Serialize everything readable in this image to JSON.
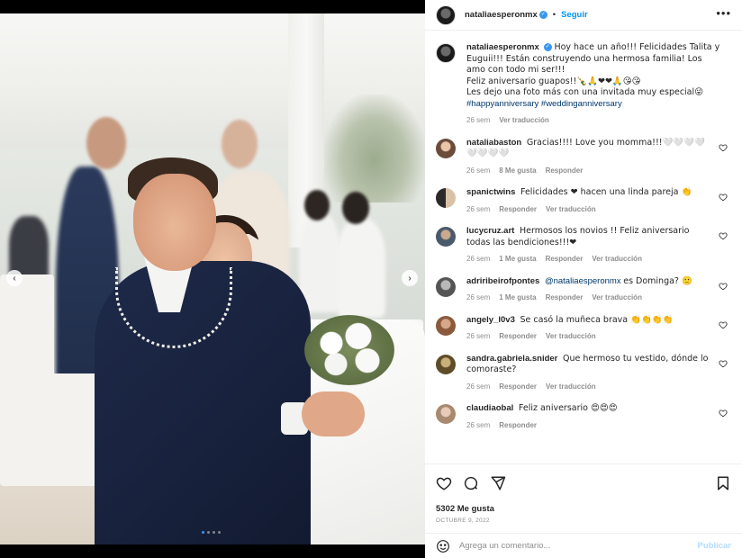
{
  "post": {
    "username": "nataliaesperonmx",
    "follow_label": "Seguir",
    "separator": "•",
    "more_label": "•••",
    "caption_lines": [
      "Hoy hace un año!!! Felicidades Talita y Euguii!!! Están construyendo una hermosa familia! Los amo con todo mi ser!!!",
      "Feliz aniversario guapos!!🍾🙏❤❤🙏😘😘",
      "Les dejo una foto más con una invitada muy especial😜"
    ],
    "hashtags": "#happyanniversary #weddinganniversary",
    "time": "26 sem",
    "translate_label": "Ver traducción"
  },
  "carousel": {
    "prev_label": "‹",
    "next_label": "›",
    "slides": 4,
    "active_slide": 1
  },
  "comments": [
    {
      "user": "nataliabaston",
      "text": "Gracias!!!! Love you momma!!!🤍🤍🤍🤍🤍🤍🤍🤍",
      "time": "26 sem",
      "likes": "8 Me gusta",
      "reply": "Responder",
      "translate": ""
    },
    {
      "user": "spanictwins",
      "text": "Felicidades ❤ hacen una linda pareja 👏",
      "time": "26 sem",
      "likes": "",
      "reply": "Responder",
      "translate": "Ver traducción"
    },
    {
      "user": "lucycruz.art",
      "text": "Hermosos los novios !! Feliz aniversario todas las bendiciones!!!❤",
      "time": "26 sem",
      "likes": "1 Me gusta",
      "reply": "Responder",
      "translate": "Ver traducción"
    },
    {
      "user": "adriribeirofpontes",
      "mention": "@nataliaesperonmx",
      "text": "es Dominga? 🙂",
      "time": "26 sem",
      "likes": "1 Me gusta",
      "reply": "Responder",
      "translate": "Ver traducción"
    },
    {
      "user": "angely_l0v3",
      "text": "Se casó la muñeca brava 👏👏👏👏",
      "time": "26 sem",
      "likes": "",
      "reply": "Responder",
      "translate": "Ver traducción"
    },
    {
      "user": "sandra.gabriela.snider",
      "text": "Que hermoso tu vestido, dónde lo comoraste?",
      "time": "26 sem",
      "likes": "",
      "reply": "Responder",
      "translate": "Ver traducción"
    },
    {
      "user": "claudiaobal",
      "text": "Feliz aniversario 😍😍😍",
      "time": "26 sem",
      "likes": "",
      "reply": "Responder",
      "translate": ""
    }
  ],
  "actions": {
    "likes_count": "5302 Me gusta",
    "date": "OCTUBRE 9, 2022"
  },
  "composer": {
    "placeholder": "Agrega un comentario...",
    "publish_label": "Publicar"
  },
  "colors": {
    "accent": "#0095f6",
    "verified": "#3897f0",
    "publish_disabled": "#b3dbff",
    "text": "#262626",
    "secondary_text": "#8e8e8e",
    "heart": "#ed4956"
  }
}
